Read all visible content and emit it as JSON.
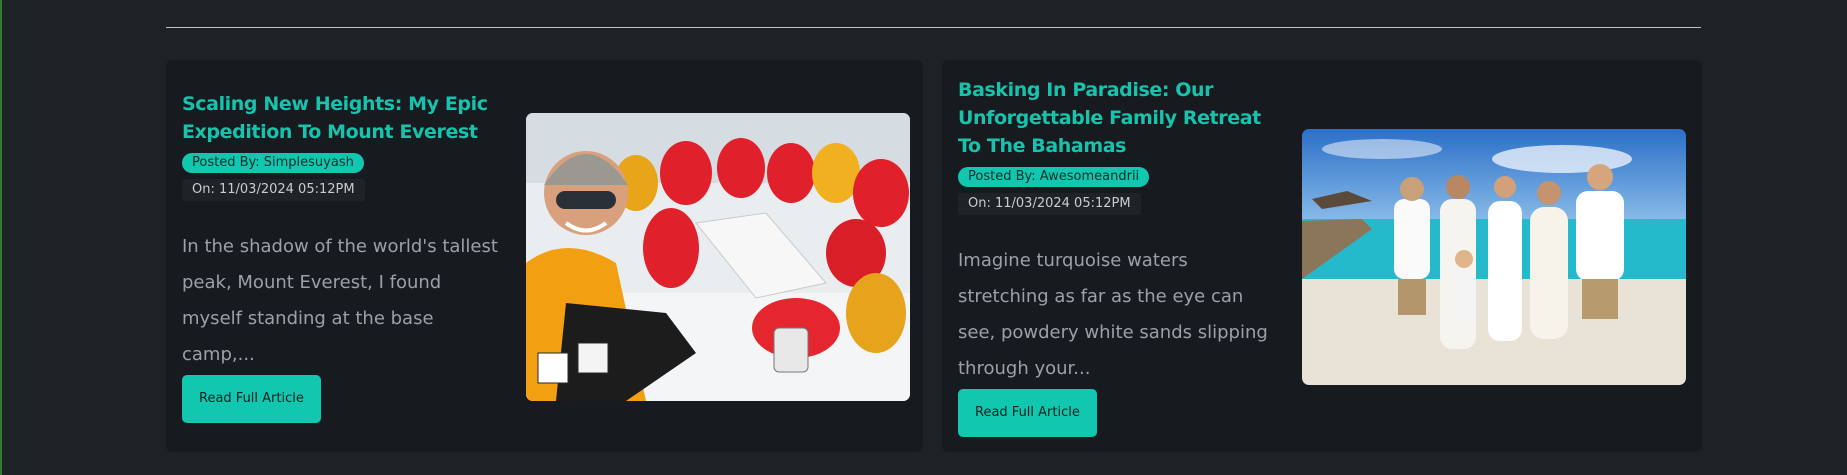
{
  "articles": [
    {
      "title": "Scaling New Heights: My Epic Expedition To Mount Everest",
      "posted_by": "Posted By: Simplesuyash",
      "posted_on": "On: 11/03/2024 05:12PM",
      "excerpt": "In the shadow of the world's tallest peak, Mount Everest, I found myself standing at the base camp,...",
      "button_label": "Read Full Article",
      "image": "everest-basecamp-photo"
    },
    {
      "title": "Basking In Paradise: Our Unforgettable Family Retreat To The Bahamas",
      "posted_by": "Posted By: Awesomeandrii",
      "posted_on": "On: 11/03/2024 05:12PM",
      "excerpt": "Imagine turquoise waters stretching as far as the eye can see, powdery white sands slipping through your...",
      "button_label": "Read Full Article",
      "image": "bahamas-family-photo"
    }
  ],
  "colors": {
    "accent": "#12c7b0",
    "title": "#17c3ad",
    "background": "#1e2227",
    "card": "#171b20"
  }
}
